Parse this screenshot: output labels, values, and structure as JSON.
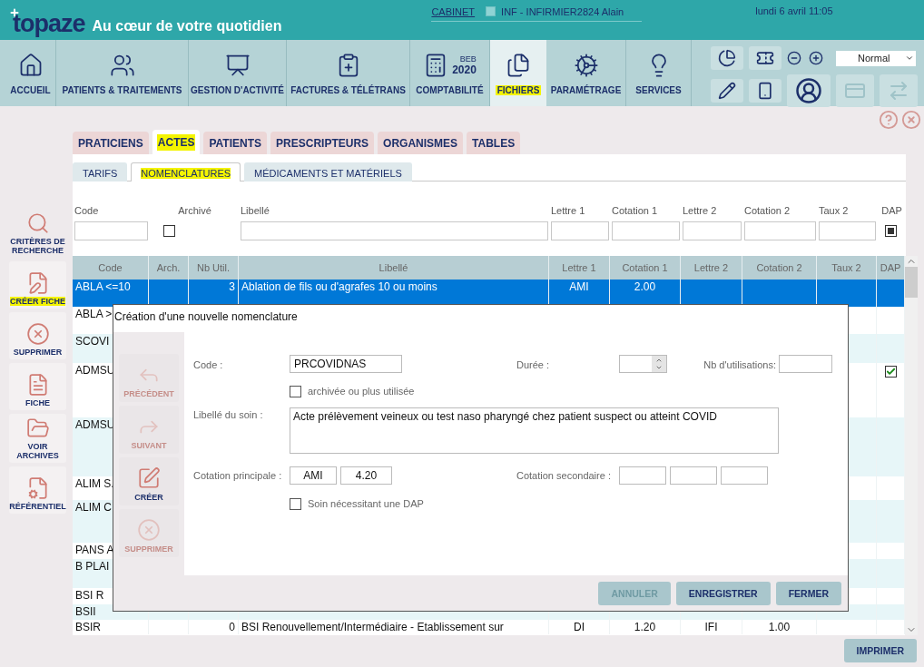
{
  "header": {
    "logo": "topaze",
    "tagline": "Au cœur de votre quotidien",
    "cabinet_link": "CABINET",
    "user": "INF - INFIRMIER2824 Alain",
    "datetime": "lundi 6 avril 11:05"
  },
  "nav": [
    {
      "label": "ACCUEIL",
      "selected": false,
      "highlighted": false
    },
    {
      "label": "PATIENTS & TRAITEMENTS",
      "selected": false,
      "highlighted": false
    },
    {
      "label": "GESTION D'ACTIVITÉ",
      "selected": false,
      "highlighted": false
    },
    {
      "label": "FACTURES & TÉLÉTRANS",
      "selected": false,
      "highlighted": false
    },
    {
      "label": "COMPTABILITÉ",
      "selected": false,
      "highlighted": false,
      "code": "BEB",
      "year": "2020"
    },
    {
      "label": "FICHIERS",
      "selected": true,
      "highlighted": true
    },
    {
      "label": "PARAMÉTRAGE",
      "selected": false,
      "highlighted": false
    },
    {
      "label": "SERVICES",
      "selected": false,
      "highlighted": false
    }
  ],
  "toolbar": {
    "zoom": "Normal"
  },
  "tabs": [
    {
      "label": "PRATICIENS",
      "selected": false,
      "highlighted": false
    },
    {
      "label": "ACTES",
      "selected": true,
      "highlighted": true
    },
    {
      "label": "PATIENTS",
      "selected": false,
      "highlighted": false
    },
    {
      "label": "PRESCRIPTEURS",
      "selected": false,
      "highlighted": false
    },
    {
      "label": "ORGANISMES",
      "selected": false,
      "highlighted": false
    },
    {
      "label": "TABLES",
      "selected": false,
      "highlighted": false
    }
  ],
  "subtabs": [
    {
      "label": "TARIFS",
      "selected": false,
      "highlighted": false
    },
    {
      "label": "NOMENCLATURES",
      "selected": true,
      "highlighted": true
    },
    {
      "label": "MÉDICAMENTS ET MATÉRIELS",
      "selected": false,
      "highlighted": false
    }
  ],
  "sidebar": [
    {
      "label": "CRITÈRES DE RECHERCHE",
      "highlighted": false
    },
    {
      "label": "CRÉER FICHE",
      "highlighted": true
    },
    {
      "label": "SUPPRIMER",
      "highlighted": false
    },
    {
      "label": "FICHE",
      "highlighted": false
    },
    {
      "label": "VOIR ARCHIVES",
      "highlighted": false
    },
    {
      "label": "RÉFÉRENTIEL",
      "highlighted": false
    }
  ],
  "filters": [
    {
      "label": "Code",
      "kind": "text"
    },
    {
      "label": "Archivé",
      "kind": "checkbox",
      "indeterminate": false
    },
    {
      "label": "Libellé",
      "kind": "text"
    },
    {
      "label": "Lettre 1",
      "kind": "text"
    },
    {
      "label": "Cotation 1",
      "kind": "text"
    },
    {
      "label": "Lettre 2",
      "kind": "text"
    },
    {
      "label": "Cotation 2",
      "kind": "text"
    },
    {
      "label": "Taux 2",
      "kind": "text"
    },
    {
      "label": "DAP",
      "kind": "checkbox",
      "indeterminate": true
    }
  ],
  "table": {
    "columns": [
      "Code",
      "Arch.",
      "Nb Util.",
      "Libellé",
      "Lettre 1",
      "Cotation 1",
      "Lettre 2",
      "Cotation 2",
      "Taux 2",
      "DAP"
    ],
    "rows": [
      {
        "code": "ABLA <=10",
        "nb_util": "3",
        "libelle": "Ablation de fils ou d'agrafes 10 ou moins",
        "lettre_1": "AMI",
        "cotation_1": "2.00",
        "selected": true,
        "dap": false
      },
      {
        "code": "ABLA >",
        "selected": false,
        "dap": false
      },
      {
        "code": "SCOVI",
        "selected": false,
        "dap": false
      },
      {
        "code": "ADMSU",
        "selected": false,
        "dap": true
      },
      {
        "code": "ADMSU",
        "selected": false,
        "dap": false
      },
      {
        "code": "ALIM S.",
        "selected": false,
        "dap": false
      },
      {
        "code": "ALIM C",
        "selected": false,
        "dap": false
      },
      {
        "code": "PANS A",
        "selected": false,
        "dap": false
      },
      {
        "code": "B PLAI",
        "selected": false,
        "dap": false
      },
      {
        "code": "BSI R",
        "selected": false,
        "dap": false
      },
      {
        "code": "BSII",
        "selected": false,
        "dap": false
      },
      {
        "code": "BSIR",
        "nb_util": "0",
        "libelle": "BSI Renouvellement/Intermédiaire - Etablissement sur",
        "lettre_1": "DI",
        "cotation_1": "1.20",
        "lettre_2": "IFI",
        "cotation_2": "1.00",
        "selected": false,
        "dap": false
      }
    ]
  },
  "print_button": "IMPRIMER",
  "dialog": {
    "title": "Création d'une nouvelle nomenclature",
    "actions": [
      {
        "label": "PRÉCÉDENT",
        "disabled": true
      },
      {
        "label": "SUIVANT",
        "disabled": true
      },
      {
        "label": "CRÉER",
        "disabled": false
      },
      {
        "label": "SUPPRIMER",
        "disabled": true
      }
    ],
    "code_label": "Code :",
    "code_value": "PRCOVIDNAS",
    "archived": {
      "label": "archivée ou plus utilisée",
      "checked": false
    },
    "duree_label": "Durée :",
    "nb_label": "Nb d'utilisations:",
    "libelle_label": "Libellé du soin :",
    "libelle_value": "Acte prélèvement veineux ou test naso pharyngé chez patient suspect ou atteint COVID",
    "cotation_label": "Cotation principale :",
    "cotation_letter": "AMI",
    "cotation_value": "4.20",
    "cotation_secondary_label": "Cotation secondaire :",
    "dap": {
      "label": "Soin nécessitant une DAP",
      "checked": false
    },
    "buttons": [
      {
        "label": "ANNULER",
        "disabled": true
      },
      {
        "label": "ENREGISTRER",
        "disabled": false
      },
      {
        "label": "FERMER",
        "disabled": false
      }
    ]
  }
}
